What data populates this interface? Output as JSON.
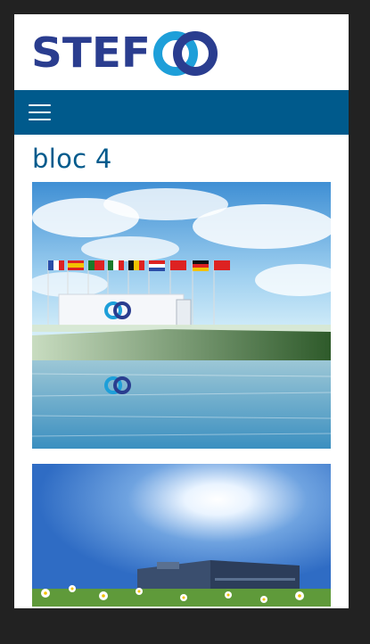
{
  "brand": {
    "logo_text": "STEF",
    "colors": {
      "primary": "#005a8c",
      "logo_blue": "#2a3d8f",
      "logo_cyan": "#1e9fd9"
    }
  },
  "nav": {
    "menu_icon": "hamburger-icon"
  },
  "main": {
    "title": "bloc 4",
    "images": [
      {
        "name": "truck-flags-lake-image"
      },
      {
        "name": "warehouse-sunflowers-image"
      }
    ]
  }
}
